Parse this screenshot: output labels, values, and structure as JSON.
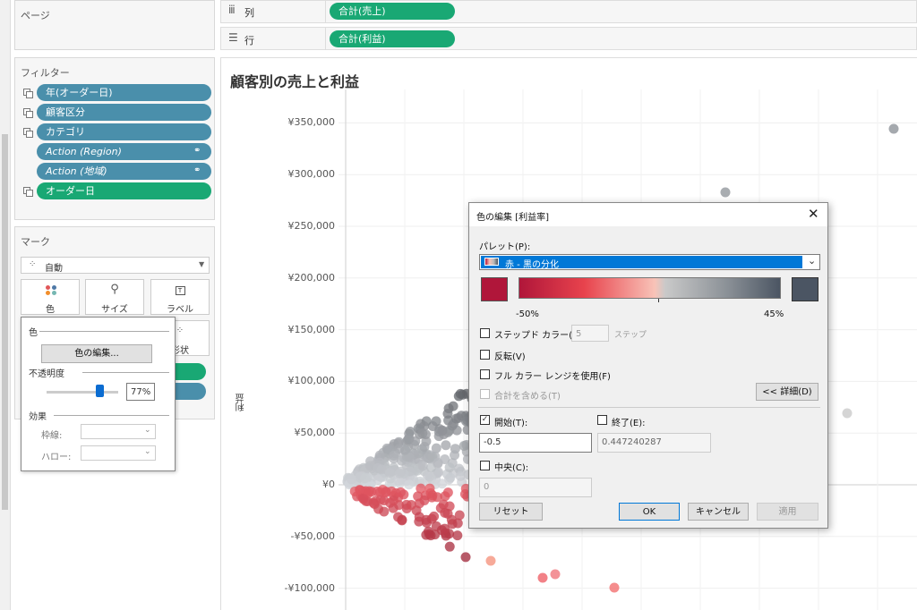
{
  "left": {
    "pages_title": "ページ",
    "filters_title": "フィルター",
    "filters": [
      "年(オーダー日)",
      "顧客区分",
      "カテゴリ",
      "Action (Region)",
      "Action (地域)",
      "オーダー日"
    ],
    "marks_title": "マーク",
    "mark_type": "自動",
    "cards": {
      "color": "色",
      "size": "サイズ",
      "label": "ラベル",
      "shape": "形状"
    }
  },
  "shelves": {
    "columns_label": "列",
    "columns_pill": "合計(売上)",
    "rows_label": "行",
    "rows_pill": "合計(利益)"
  },
  "chart_data": {
    "type": "scatter",
    "title": "顧客別の売上と利益",
    "ylabel": "利益",
    "y_ticks": [
      "¥350,000",
      "¥300,000",
      "¥250,000",
      "¥200,000",
      "¥150,000",
      "¥100,000",
      "¥50,000",
      "¥0",
      "-¥50,000",
      "-¥100,000"
    ],
    "ylim": [
      -120000,
      370000
    ],
    "grid": true
  },
  "color_popup": {
    "title": "色",
    "edit_button": "色の編集...",
    "opacity_label": "不透明度",
    "opacity_value": "77%",
    "opacity": 0.77,
    "effects_label": "効果",
    "border_label": "枠線:",
    "halo_label": "ハロー:"
  },
  "dialog": {
    "title": "色の編集 [利益率]",
    "palette_label": "パレット(P):",
    "palette_value": "赤 - 黒の分化",
    "min_label": "-50%",
    "max_label": "45%",
    "stepped_label": "ステップド カラー(S)",
    "steps_value": "5",
    "steps_unit": "ステップ",
    "reversed_label": "反転(V)",
    "full_range_label": "フル カラー レンジを使用(F)",
    "include_totals_label": "合計を含める(T)",
    "advanced_button": "<< 詳細(D)",
    "start_label": "開始(T):",
    "start_value": "-0.5",
    "end_label": "終了(E):",
    "end_value": "0.447240287",
    "center_label": "中央(C):",
    "center_value": "0",
    "reset_button": "リセット",
    "ok_button": "OK",
    "cancel_button": "キャンセル",
    "apply_button": "適用",
    "colors": {
      "start": "#b0163a",
      "end": "#4b5563"
    }
  }
}
